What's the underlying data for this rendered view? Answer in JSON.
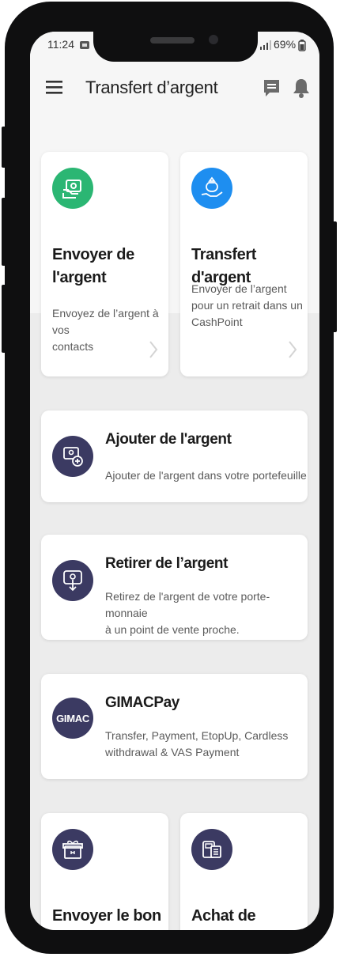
{
  "status_bar": {
    "time": "11:24",
    "battery": "69%"
  },
  "header": {
    "title": "Transfert d’argent"
  },
  "colors": {
    "green": "#2bb673",
    "blue": "#1e8ef0",
    "navy": "#3b3a62",
    "card_bg": "#ffffff",
    "screen_bg": "#ececec"
  },
  "cards": {
    "send": {
      "title_line1": "Envoyer de",
      "title_line2": "l'argent",
      "desc_line1": "Envoyez de l’argent à vos",
      "desc_line2": "contacts",
      "icon": "money-transfer-icon"
    },
    "transfer": {
      "title": "Transfert d'argent",
      "desc_line1": "Envoyer de l’argent",
      "desc_line2": "pour un retrait dans un",
      "desc_line3": "CashPoint",
      "icon": "money-bag-hand-icon"
    },
    "add": {
      "title": "Ajouter de l'argent",
      "desc": "Ajouter de l'argent dans votre portefeuille",
      "icon": "add-money-icon"
    },
    "withdraw": {
      "title": "Retirer de l’argent",
      "desc_line1": "Retirez de l'argent de votre porte-monnaie",
      "desc_line2": "à un point de vente proche.",
      "icon": "withdraw-icon"
    },
    "gimac": {
      "title": "GIMACPay",
      "logo": "GIMAC",
      "desc_line1": "Transfer, Payment, EtopUp, Cardless",
      "desc_line2": "withdrawal & VAS Payment"
    },
    "voucher": {
      "title": "Envoyer le bon",
      "icon": "gift-icon"
    },
    "currency": {
      "title": "Achat de devises",
      "icon": "currency-exchange-icon"
    }
  }
}
